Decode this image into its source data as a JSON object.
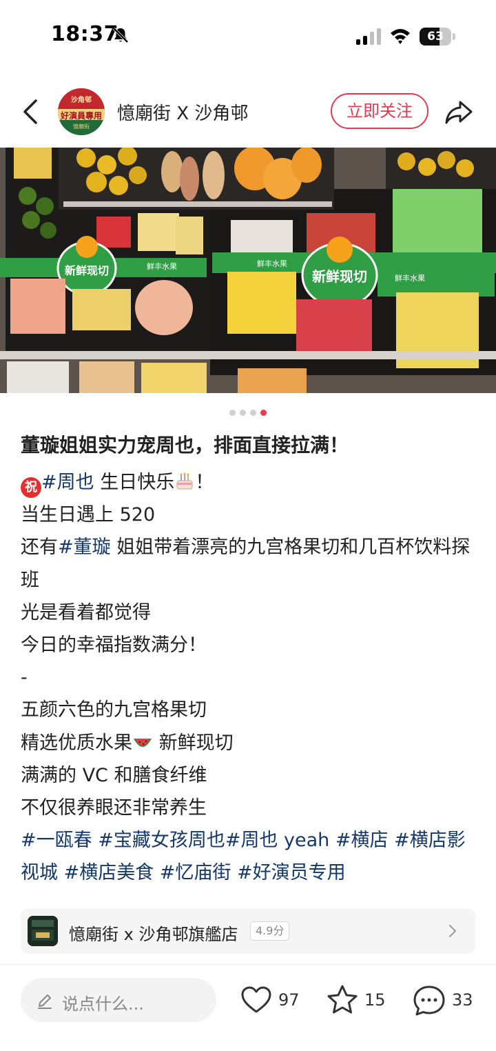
{
  "status_bar": {
    "time": "18:37",
    "battery": "63",
    "battery_level": 0.63
  },
  "header": {
    "author_name": "憶廟街 X 沙角邨",
    "follow_label": "立即关注",
    "avatar_text": {
      "top": "沙角邨",
      "mid": "好演員專用",
      "bottom": "憶廟街"
    }
  },
  "carousel": {
    "total": 4,
    "active_index": 3
  },
  "post": {
    "title": "董璇姐姐实力宠周也，排面直接拉满！",
    "line1": {
      "emoji": "祝",
      "tag": "#周也",
      "text": " 生日快乐",
      "end": "！"
    },
    "line2": "当生日遇上 520",
    "line3": {
      "prefix": "还有",
      "tag": "#董璇",
      "text": " 姐姐带着漂亮的九宫格果切和几百杯饮料探班"
    },
    "line4": "光是看着都觉得",
    "line5": "今日的幸福指数满分！",
    "line6": "-",
    "line7": "五颜六色的九宫格果切",
    "line8": {
      "text1": "精选优质水果",
      "text2": " 新鲜现切"
    },
    "line9": "满满的 VC 和膳食纤维",
    "line10": "不仅很养眼还非常养生",
    "tags_text": "#一瓯春 #宝藏女孩周也#周也 yeah #横店 #横店影视城 #横店美食 #忆庙街 #好演员专用"
  },
  "shop": {
    "name": "憶廟街 x 沙角邨旗艦店",
    "rating": "4.9分"
  },
  "bottom_bar": {
    "comment_placeholder": "说点什么...",
    "likes": "97",
    "favorites": "15",
    "comments": "33"
  },
  "photo_labels": {
    "sticker": "新鲜现切",
    "brand": "鲜丰水果"
  },
  "colors": {
    "accent": "#e83a4f",
    "tag": "#13386c",
    "label_green": "#2f9e44"
  }
}
